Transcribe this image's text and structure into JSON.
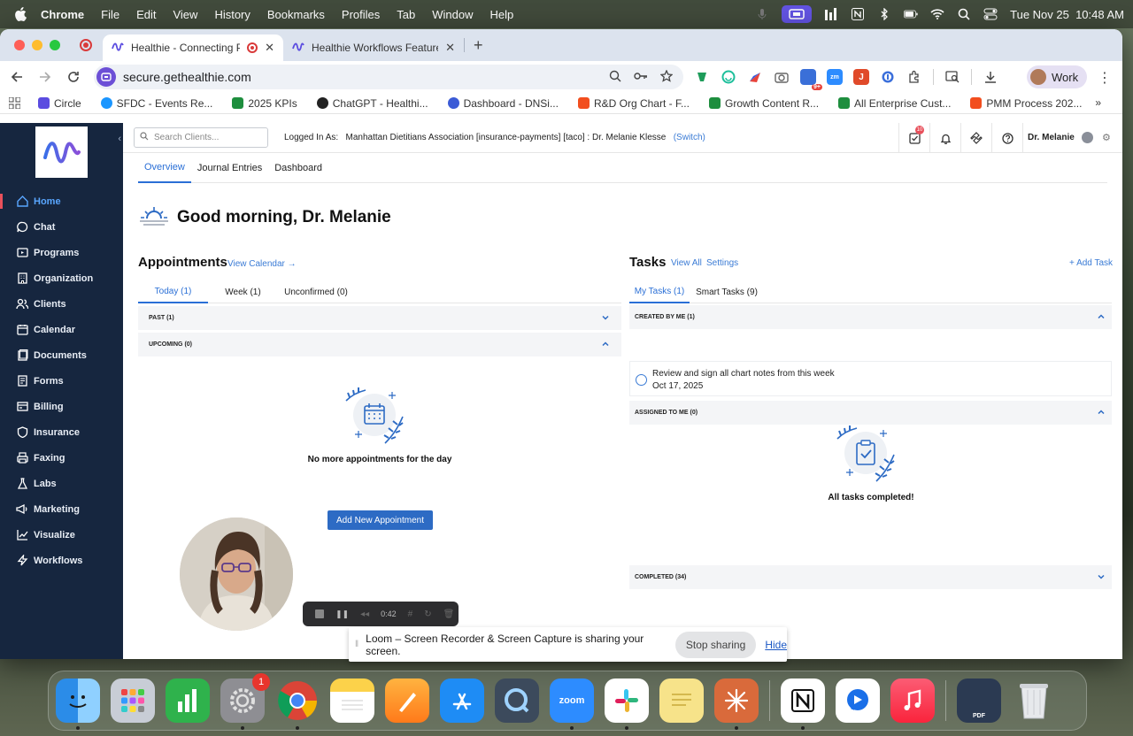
{
  "menubar": {
    "app_name": "Chrome",
    "items": [
      "File",
      "Edit",
      "View",
      "History",
      "Bookmarks",
      "Profiles",
      "Tab",
      "Window",
      "Help"
    ],
    "datetime": "Tue Nov 25  10:48 AM"
  },
  "browser": {
    "tabs": [
      {
        "title": "Healthie - Connecting Pro",
        "active": true
      },
      {
        "title": "Healthie Workflows Feature -",
        "active": false
      }
    ],
    "url": "secure.gethealthie.com",
    "profile_label": "Work",
    "ext_badge": "9+",
    "bookmarks": [
      {
        "label": "Circle",
        "color": "#5b4ce0"
      },
      {
        "label": "SFDC - Events Re...",
        "color": "#1b96ff"
      },
      {
        "label": "2025 KPIs",
        "color": "#1e8e3e"
      },
      {
        "label": "ChatGPT - Healthi...",
        "color": "#222222"
      },
      {
        "label": "Dashboard - DNSi...",
        "color": "#3b5bd6"
      },
      {
        "label": "R&D Org Chart - F...",
        "color": "#f24e1e"
      },
      {
        "label": "Growth Content R...",
        "color": "#1e8e3e"
      },
      {
        "label": "All Enterprise Cust...",
        "color": "#1e8e3e"
      },
      {
        "label": "PMM Process 202...",
        "color": "#f24e1e"
      }
    ]
  },
  "sidebar": {
    "items": [
      {
        "label": "Home",
        "icon": "home-icon",
        "active": true
      },
      {
        "label": "Chat",
        "icon": "chat-icon"
      },
      {
        "label": "Programs",
        "icon": "programs-icon"
      },
      {
        "label": "Organization",
        "icon": "organization-icon"
      },
      {
        "label": "Clients",
        "icon": "clients-icon"
      },
      {
        "label": "Calendar",
        "icon": "calendar-icon"
      },
      {
        "label": "Documents",
        "icon": "documents-icon"
      },
      {
        "label": "Forms",
        "icon": "forms-icon"
      },
      {
        "label": "Billing",
        "icon": "billing-icon"
      },
      {
        "label": "Insurance",
        "icon": "insurance-icon"
      },
      {
        "label": "Faxing",
        "icon": "fax-icon"
      },
      {
        "label": "Labs",
        "icon": "labs-icon"
      },
      {
        "label": "Marketing",
        "icon": "marketing-icon"
      },
      {
        "label": "Visualize",
        "icon": "visualize-icon"
      },
      {
        "label": "Workflows",
        "icon": "workflows-icon"
      }
    ]
  },
  "topbar": {
    "search_placeholder": "Search Clients...",
    "logged_in_label": "Logged In As:",
    "logged_in_value": "Manhattan Dietitians Association [insurance-payments] [taco] : Dr. Melanie Klesse",
    "switch_label": "(Switch)",
    "tasks_badge": "10",
    "user_name": "Dr. Melanie"
  },
  "subtabs": [
    "Overview",
    "Journal Entries",
    "Dashboard"
  ],
  "greeting": "Good morning, Dr. Melanie",
  "appointments": {
    "title": "Appointments",
    "view_calendar": "View Calendar →",
    "tabs": [
      "Today (1)",
      "Week (1)",
      "Unconfirmed (0)"
    ],
    "past_label": "PAST (1)",
    "upcoming_label": "UPCOMING (0)",
    "empty_text": "No more appointments for the day",
    "add_button": "Add New Appointment"
  },
  "tasks": {
    "title": "Tasks",
    "view_all": "View All",
    "settings": "Settings",
    "add_task": "+ Add Task",
    "tabs": [
      "My Tasks (1)",
      "Smart Tasks (9)"
    ],
    "created_by_me": "CREATED BY ME (1)",
    "task_text": "Review and sign all chart notes from this week",
    "task_date": "Oct 17, 2025",
    "assigned_to_me": "ASSIGNED TO ME (0)",
    "empty_text": "All tasks completed!",
    "completed": "COMPLETED (34)"
  },
  "loom": {
    "timer": "0:42",
    "share_message": "Loom – Screen Recorder & Screen Capture is sharing your screen.",
    "stop_label": "Stop sharing",
    "hide_label": "Hide"
  },
  "dock": {
    "settings_badge": "1",
    "zoom_label": "zoom",
    "pdf_label": "PDF"
  },
  "colors": {
    "sidebar_bg": "#16263f",
    "accent_blue": "#2d6bc4",
    "active_nav": "#59a6ff",
    "brand_purple": "#6c4fd6"
  }
}
